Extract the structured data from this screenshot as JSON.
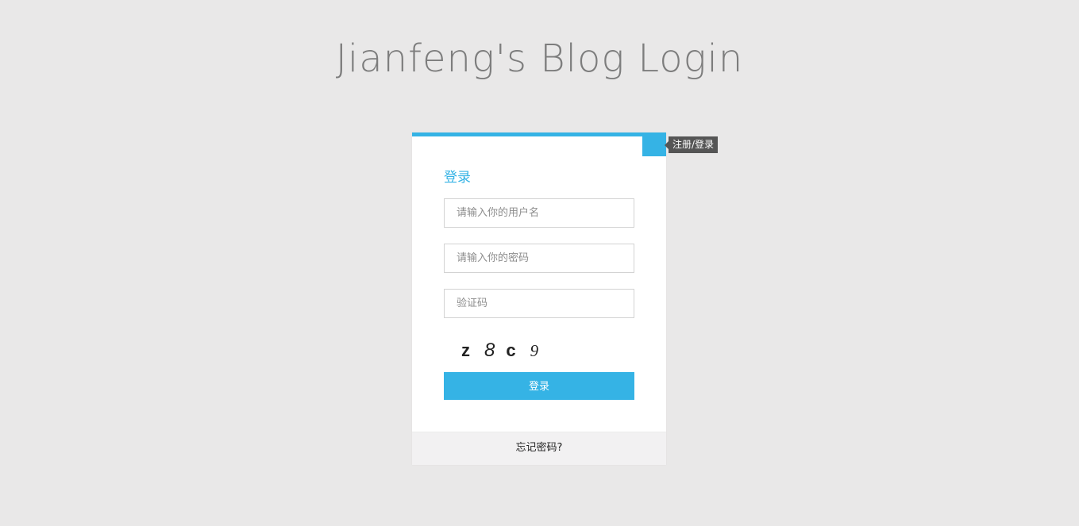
{
  "page": {
    "title": "Jianfeng's Blog Login"
  },
  "card": {
    "toggle_tooltip": "注册/登录",
    "heading": "登录",
    "username_placeholder": "请输入你的用户名",
    "password_placeholder": "请输入你的密码",
    "captcha_placeholder": "验证码",
    "captcha_chars": [
      "z",
      "8",
      "c",
      "9"
    ],
    "submit_label": "登录",
    "forgot_label": "忘记密码?"
  },
  "colors": {
    "accent": "#35b3e5",
    "background": "#e9e8e8",
    "tooltip_bg": "#555555"
  }
}
